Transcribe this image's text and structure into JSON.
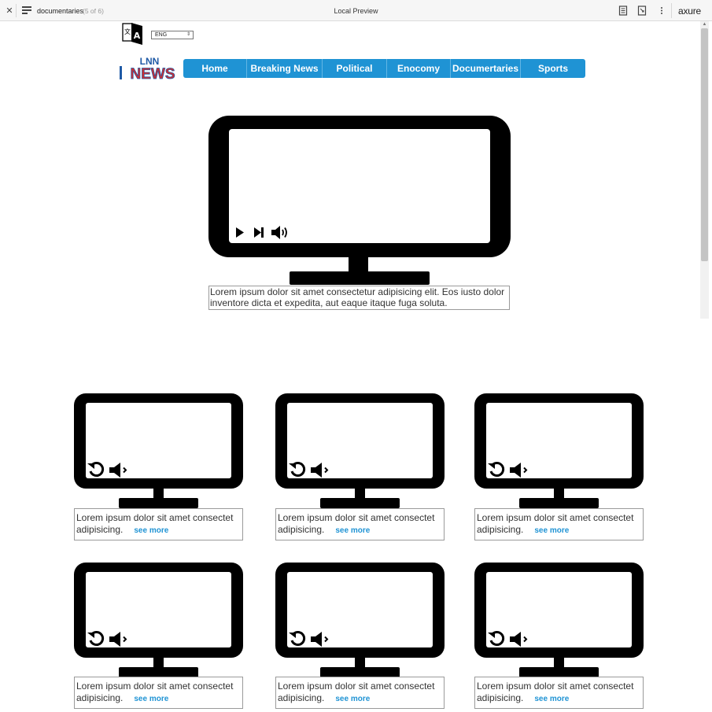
{
  "preview_bar": {
    "page_name": "documentaries",
    "page_count": "(5 of 6)",
    "title": "Local Preview",
    "brand": "axure",
    "icons": [
      "close-icon",
      "menu-icon",
      "notes-icon",
      "inspect-icon",
      "more-icon"
    ]
  },
  "header": {
    "language": "ENG",
    "language_icon": "translate-icon",
    "logo": {
      "top": "LNN",
      "bottom": "NEWS",
      "colors": {
        "lnn": "#1f5aa6",
        "news_fill": "#d62b2b"
      }
    }
  },
  "nav": {
    "color": "#1f93d4",
    "items": [
      "Home",
      "Breaking News",
      "Political",
      "Enocomy",
      "Documertaries",
      "Sports"
    ]
  },
  "main": {
    "video_controls": [
      "play-icon",
      "skip-next-icon",
      "volume-icon"
    ],
    "caption": "Lorem ipsum dolor sit amet consectetur adipisicing elit. Eos iusto dolor inventore dicta et expedita, aut eaque itaque fuga soluta."
  },
  "thumbnails": {
    "controls": [
      "replay-icon",
      "volume-low-icon"
    ],
    "items": [
      {
        "text": "Lorem ipsum dolor sit amet consectet adipisicing.",
        "link": "see more"
      },
      {
        "text": "Lorem ipsum dolor sit amet consectet adipisicing.",
        "link": "see more"
      },
      {
        "text": "Lorem ipsum dolor sit amet consectet adipisicing.",
        "link": "see more"
      },
      {
        "text": "Lorem ipsum dolor sit amet consectet adipisicing.",
        "link": "see more"
      },
      {
        "text": "Lorem ipsum dolor sit amet consectet adipisicing.",
        "link": "see more"
      },
      {
        "text": "Lorem ipsum dolor sit amet consectet adipisicing.",
        "link": "see more"
      }
    ]
  }
}
